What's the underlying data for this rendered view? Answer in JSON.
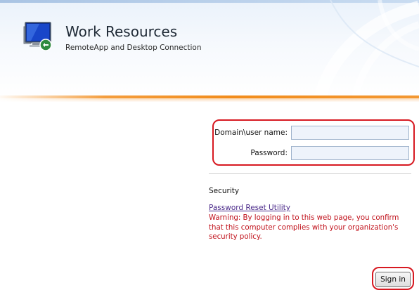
{
  "header": {
    "title": "Work Resources",
    "subtitle": "RemoteApp and Desktop Connection",
    "logo_icon": "remote-desktop-monitor-icon"
  },
  "login_form": {
    "username_label": "Domain\\user name:",
    "username_value": "",
    "password_label": "Password:",
    "password_value": ""
  },
  "security": {
    "heading": "Security",
    "reset_link": "Password Reset Utility",
    "warning": "Warning: By logging in to this web page, you confirm that this computer complies with your organization's security policy."
  },
  "actions": {
    "sign_in_label": "Sign in"
  },
  "colors": {
    "highlight": "#d71921",
    "accent_orange": "#f28c1c",
    "warning_text": "#c0101a",
    "link": "#4b2a8a"
  }
}
